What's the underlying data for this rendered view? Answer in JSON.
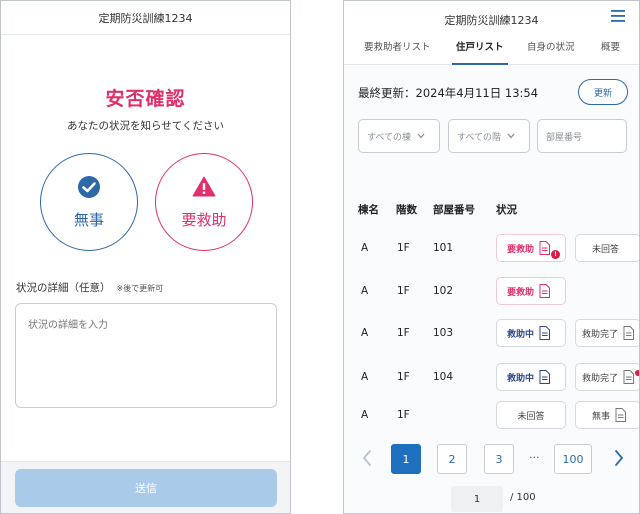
{
  "left": {
    "app_title": "定期防災訓練1234",
    "heading": "安否確認",
    "subheading": "あなたの状況を知らせてください",
    "safe_label": "無事",
    "help_label": "要救助",
    "detail_label": "状況の詳細（任意）",
    "detail_note": "※後で更新可",
    "detail_placeholder": "状況の詳細を入力",
    "submit_label": "送信",
    "colors": {
      "brand_blue": "#2d68a8",
      "alert_pink": "#e0306a",
      "submit_disabled": "#a9cbe9"
    }
  },
  "right": {
    "app_title": "定期防災訓練1234",
    "tabs": [
      {
        "label": "要救助者リスト",
        "active": false
      },
      {
        "label": "住戸リスト",
        "active": true
      },
      {
        "label": "自身の状況",
        "active": false
      },
      {
        "label": "概要",
        "active": false
      }
    ],
    "last_updated": "最終更新：2024年4月11日 13:54",
    "refresh_label": "更新",
    "filters": {
      "building": "すべての棟",
      "floor": "すべての階",
      "room_placeholder": "部屋番号"
    },
    "columns": [
      "棟名",
      "階数",
      "部屋番号",
      "状況"
    ],
    "rows": [
      {
        "building": "A",
        "floor": "1F",
        "room": "101",
        "status": "要救助",
        "status_type": "help",
        "status_alert": true,
        "status_alert_text": "!",
        "second": "未回答",
        "second_doc": false
      },
      {
        "building": "A",
        "floor": "1F",
        "room": "102",
        "status": "要救助",
        "status_type": "help",
        "status_alert": false,
        "second": "",
        "second_doc": false
      },
      {
        "building": "A",
        "floor": "1F",
        "room": "103",
        "status": "救助中",
        "status_type": "rescuing",
        "status_alert": false,
        "second": "救助完了",
        "second_doc": true
      },
      {
        "building": "A",
        "floor": "1F",
        "room": "104",
        "status": "救助中",
        "status_type": "rescuing",
        "status_alert": false,
        "second": "救助完了",
        "second_doc": true,
        "second_alert": true
      },
      {
        "building": "A",
        "floor": "1F",
        "room": "",
        "status": "未回答",
        "status_type": "none",
        "status_alert": false,
        "second": "無事",
        "second_doc": true
      }
    ],
    "pagination": {
      "pages": [
        "1",
        "2",
        "3"
      ],
      "ellipsis": "···",
      "last": "100",
      "current_input": "1",
      "total": "/ 100"
    }
  }
}
